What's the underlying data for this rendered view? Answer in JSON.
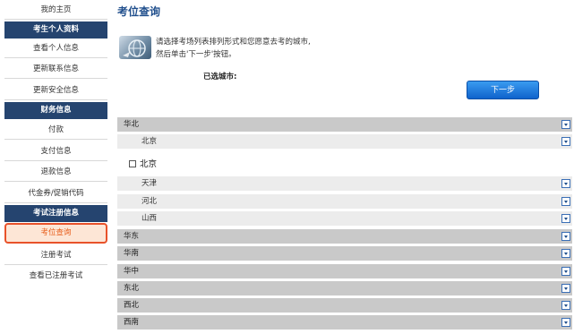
{
  "sidebar": {
    "my_home": "我的主页",
    "section_personal": "考生个人资料",
    "view_personal": "查看个人信息",
    "update_contact": "更新联系信息",
    "update_security": "更新安全信息",
    "section_finance": "财务信息",
    "payment": "付款",
    "payment_info": "支付信息",
    "refund_info": "退款信息",
    "voucher": "代金券/促销代码",
    "section_exam": "考试注册信息",
    "seat_query": "考位查询",
    "register_exam": "注册考试",
    "view_registered": "查看已注册考试"
  },
  "main": {
    "title": "考位查询",
    "info_line1": "请选择考场列表排列形式和您愿意去考的城市,",
    "info_line2": "然后单击'下一步'按钮。",
    "selected_city_label": "已选城市:",
    "next_button": "下一步",
    "checkbox_city": "北京",
    "regions": {
      "north": "华北",
      "beijing": "北京",
      "tianjin": "天津",
      "hebei": "河北",
      "shanxi": "山西",
      "east": "华东",
      "south": "华南",
      "central": "华中",
      "northeast": "东北",
      "northwest": "西北",
      "southwest": "西南"
    }
  },
  "colors": {
    "title": "#1f4e8c",
    "sidebar_header": "#25446f",
    "active_border": "#e8522a",
    "button": "#1a73dd"
  }
}
